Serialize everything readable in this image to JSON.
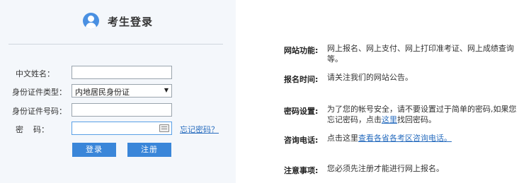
{
  "login": {
    "title": "考生登录",
    "name_label": "中文姓名：",
    "id_type_label": "身份证件类型：",
    "id_type_value": "内地居民身份证",
    "id_number_label": "身份证件号码：",
    "password_label": "密    码：",
    "forgot_link": "忘记密码？",
    "login_button": "登录",
    "register_button": "注册"
  },
  "info": {
    "function_label": "网站功能:",
    "function_text": "网上报名、网上支付、网上打印准考证、网上成绩查询等。",
    "time_label": "报名时间:",
    "time_text": "请关注我们的网站公告。",
    "password_label": "密码设置:",
    "password_text_1": "为了您的帐号安全，请不要设置过于简单的密码,如果您忘记密码，点击",
    "password_link": "这里",
    "password_text_2": "找回密码。",
    "phone_label": "咨询电话:",
    "phone_text": "点击这里",
    "phone_link": "查看各省各考区咨询电话。",
    "notice_label": "注意事项:",
    "notice_text": "您必须先注册才能进行网上报名。"
  }
}
